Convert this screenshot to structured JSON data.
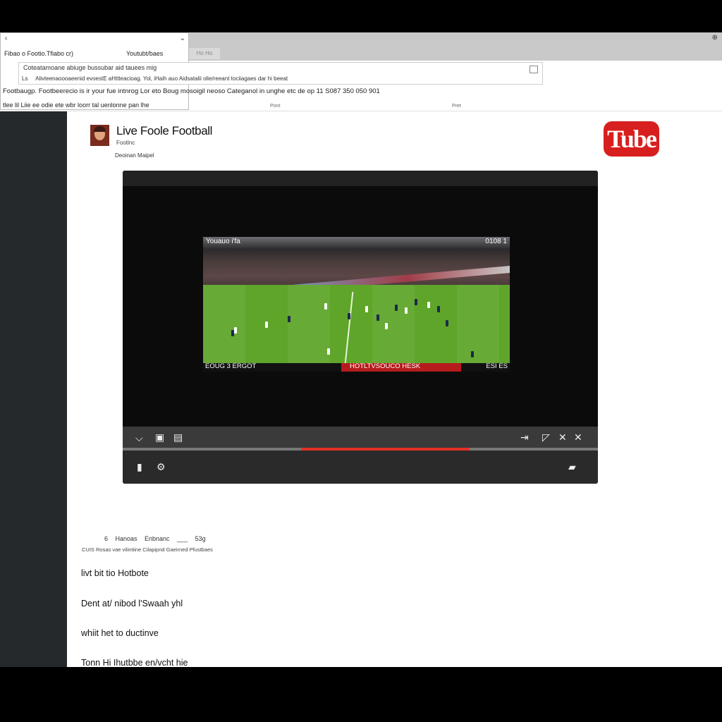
{
  "browser": {
    "tab_label": "Ho Ho",
    "corner_icon": "info-icon",
    "dropdown": {
      "left_text": "Fibao o Footio.Tfiabo cr)",
      "right_text": "Youtubt/baes"
    }
  },
  "search": {
    "line1": "Coteatamoane abiuge bussubar aid tauees mig",
    "line2_prefix": "Ls",
    "line2": "Alivteenaoooaeenid evoestE aHttteacioag. Yol, iHaih auo Aidsatalii olie/reeant tociiagaes dar hi beeat"
  },
  "description": {
    "line1": "Footbaugp. Footbeerecio is ir your fue intnrog Lor eto Boug mosoigil neoso Categanol in unghe etc de op 11 S087 350 050 901",
    "line2": "tlee lil Liie ee odie ete wbr loorr tal uenlonne pan lhe",
    "meta_left": "Pont",
    "meta_right": "Pret"
  },
  "channel": {
    "name": "Live Foole Football",
    "subtitle": "Footlnc",
    "subscribers": "Deoinan Maipel"
  },
  "logo": {
    "text": "Tube",
    "color": "#d81f1f"
  },
  "video": {
    "overlay_top_left": "Youauo i'fa",
    "overlay_top_right": "0108 1",
    "score_left": "EOUG 3 ERGOT",
    "score_center": "HOTLTVSOUCO HESK",
    "score_right": "ESI ES",
    "progress_fraction": 0.73,
    "played_start_fraction": 0.375
  },
  "controls": {
    "left_icons": [
      "chevron-down-icon",
      "captions-icon",
      "screen-icon"
    ],
    "right_icons": [
      "skip-icon",
      "miniplayer-icon",
      "expand-icon",
      "close-icon"
    ],
    "bottom_left_icons": [
      "volume-icon",
      "settings-icon"
    ],
    "bottom_right_icon": "cast-icon"
  },
  "below": {
    "stats_line": "6 Hanoas Enbnanc ___ 53g",
    "tags_line": "CUIS Rosas vae vilintiine Cilapipnd Gaeirned Pfustbaes",
    "links": [
      "livt bit tio Hotbote",
      "Dent at/ nibod l'Swaah yhl",
      "whiit het to ductinve",
      "Tonn Hi Ihutbbe en/vcht hie"
    ]
  }
}
